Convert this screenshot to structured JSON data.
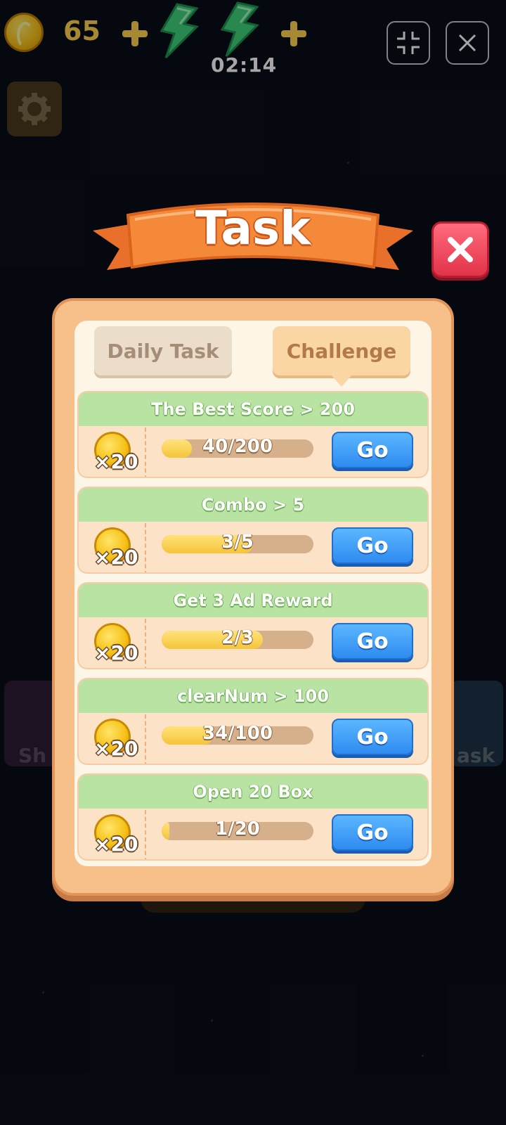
{
  "top_bar": {
    "coin_count": "65",
    "timer": "02:14",
    "icons": [
      "coin-icon",
      "plus-icon",
      "energy-bolt-icon",
      "plus-icon",
      "shrink-icon",
      "close-icon"
    ]
  },
  "background": {
    "shop_label": "Sh",
    "task_label": "ask"
  },
  "dialog": {
    "title": "Task",
    "tabs": [
      {
        "label": "Daily Task",
        "selected": false
      },
      {
        "label": "Challenge",
        "selected": true
      }
    ],
    "tasks": [
      {
        "title": "The Best Score > 200",
        "reward": "×20",
        "progress_text": "40/200",
        "progress": 0.2,
        "button": "Go"
      },
      {
        "title": "Combo > 5",
        "reward": "×20",
        "progress_text": "3/5",
        "progress": 0.6,
        "button": "Go"
      },
      {
        "title": "Get 3 Ad Reward",
        "reward": "×20",
        "progress_text": "2/3",
        "progress": 0.667,
        "button": "Go"
      },
      {
        "title": "clearNum > 100",
        "reward": "×20",
        "progress_text": "34/100",
        "progress": 0.34,
        "button": "Go"
      },
      {
        "title": "Open 20 Box",
        "reward": "×20",
        "progress_text": "1/20",
        "progress": 0.05,
        "button": "Go"
      }
    ]
  },
  "colors": {
    "panel": "#f7c08a",
    "ribbon": "#f5893a",
    "header_green": "#b9e3a2",
    "go_blue": "#2f8bf0",
    "close_red": "#e23349",
    "coin_gold": "#f7c21a"
  }
}
